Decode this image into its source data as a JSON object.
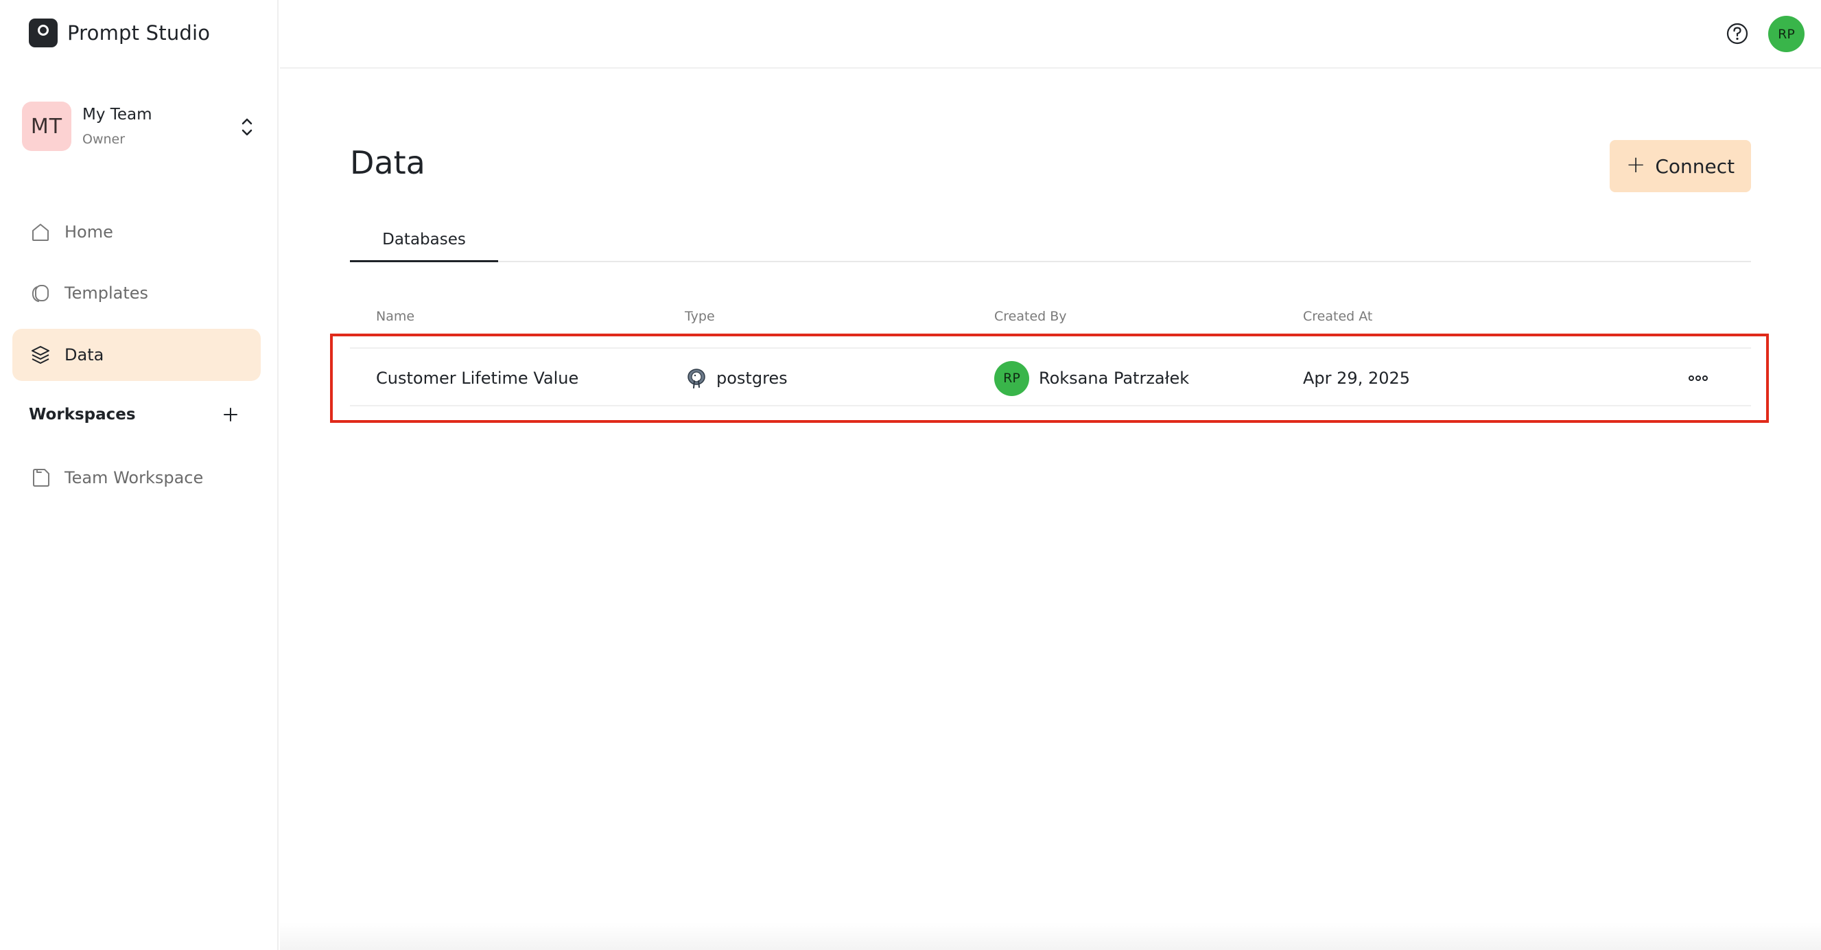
{
  "brand": {
    "name": "Prompt Studio"
  },
  "team": {
    "initials": "MT",
    "name": "My Team",
    "role": "Owner"
  },
  "sidebar": {
    "nav": [
      {
        "label": "Home",
        "icon": "home-icon"
      },
      {
        "label": "Templates",
        "icon": "templates-icon"
      },
      {
        "label": "Data",
        "icon": "layers-icon",
        "active": true
      }
    ],
    "workspaces_title": "Workspaces",
    "workspaces": [
      {
        "label": "Team Workspace",
        "icon": "workspace-icon"
      }
    ]
  },
  "topbar": {
    "user_initials": "RP"
  },
  "main": {
    "title": "Data",
    "connect_label": "Connect",
    "tabs": [
      {
        "label": "Databases",
        "active": true
      }
    ],
    "table": {
      "columns": [
        "Name",
        "Type",
        "Created By",
        "Created At"
      ],
      "rows": [
        {
          "name": "Customer Lifetime Value",
          "type": "postgres",
          "created_by": {
            "initials": "RP",
            "name": "Roksana Patrzałek"
          },
          "created_at": "Apr 29, 2025"
        }
      ]
    }
  },
  "colors": {
    "accent_bg": "#fdebd8",
    "connect_bg": "#fde1c3",
    "avatar_green": "#39b54a",
    "team_avatar_bg": "#fcd2d2",
    "highlight": "#e02a1a"
  }
}
